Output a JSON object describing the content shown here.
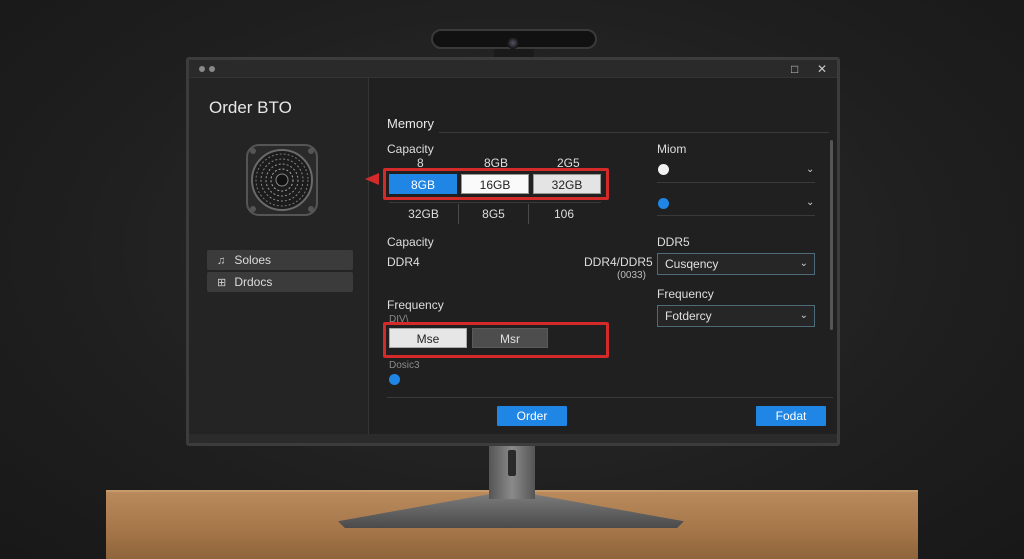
{
  "window": {
    "title": "Order BTO",
    "maximize_icon": "□",
    "close_icon": "✕"
  },
  "sidebar": {
    "items": [
      {
        "label": "Soloes",
        "icon": "♫"
      },
      {
        "label": "Drdocs",
        "icon": "⊞"
      }
    ]
  },
  "memory": {
    "section_title": "Memory",
    "capacity_label": "Capacity",
    "header_row": [
      "8",
      "8GB",
      "2G5"
    ],
    "options": [
      "8GB",
      "16GB",
      "32GB"
    ],
    "selected": "8GB",
    "row2": [
      "32GB",
      "8G5",
      "106"
    ],
    "capacity2_label": "Capacity",
    "type_left": "DDR4",
    "type_right": "DDR4/DDR5",
    "type_right_sub": "(0033)",
    "frequency_label": "Frequency",
    "freq_top_fragment": "DIV\\",
    "freq_options": [
      "Mse",
      "Msr"
    ],
    "freq_bottom_fragment": "Dosic3"
  },
  "right_panel": {
    "label": "Miom",
    "ddr_label": "DDR5",
    "select1_value": "Cusqency",
    "frequency_label": "Frequency",
    "select2_value": "Fotdercy"
  },
  "actions": {
    "order_label": "Order",
    "secondary_label": "Fodat"
  },
  "colors": {
    "accent": "#1f86e5",
    "highlight": "#d42a2a"
  }
}
